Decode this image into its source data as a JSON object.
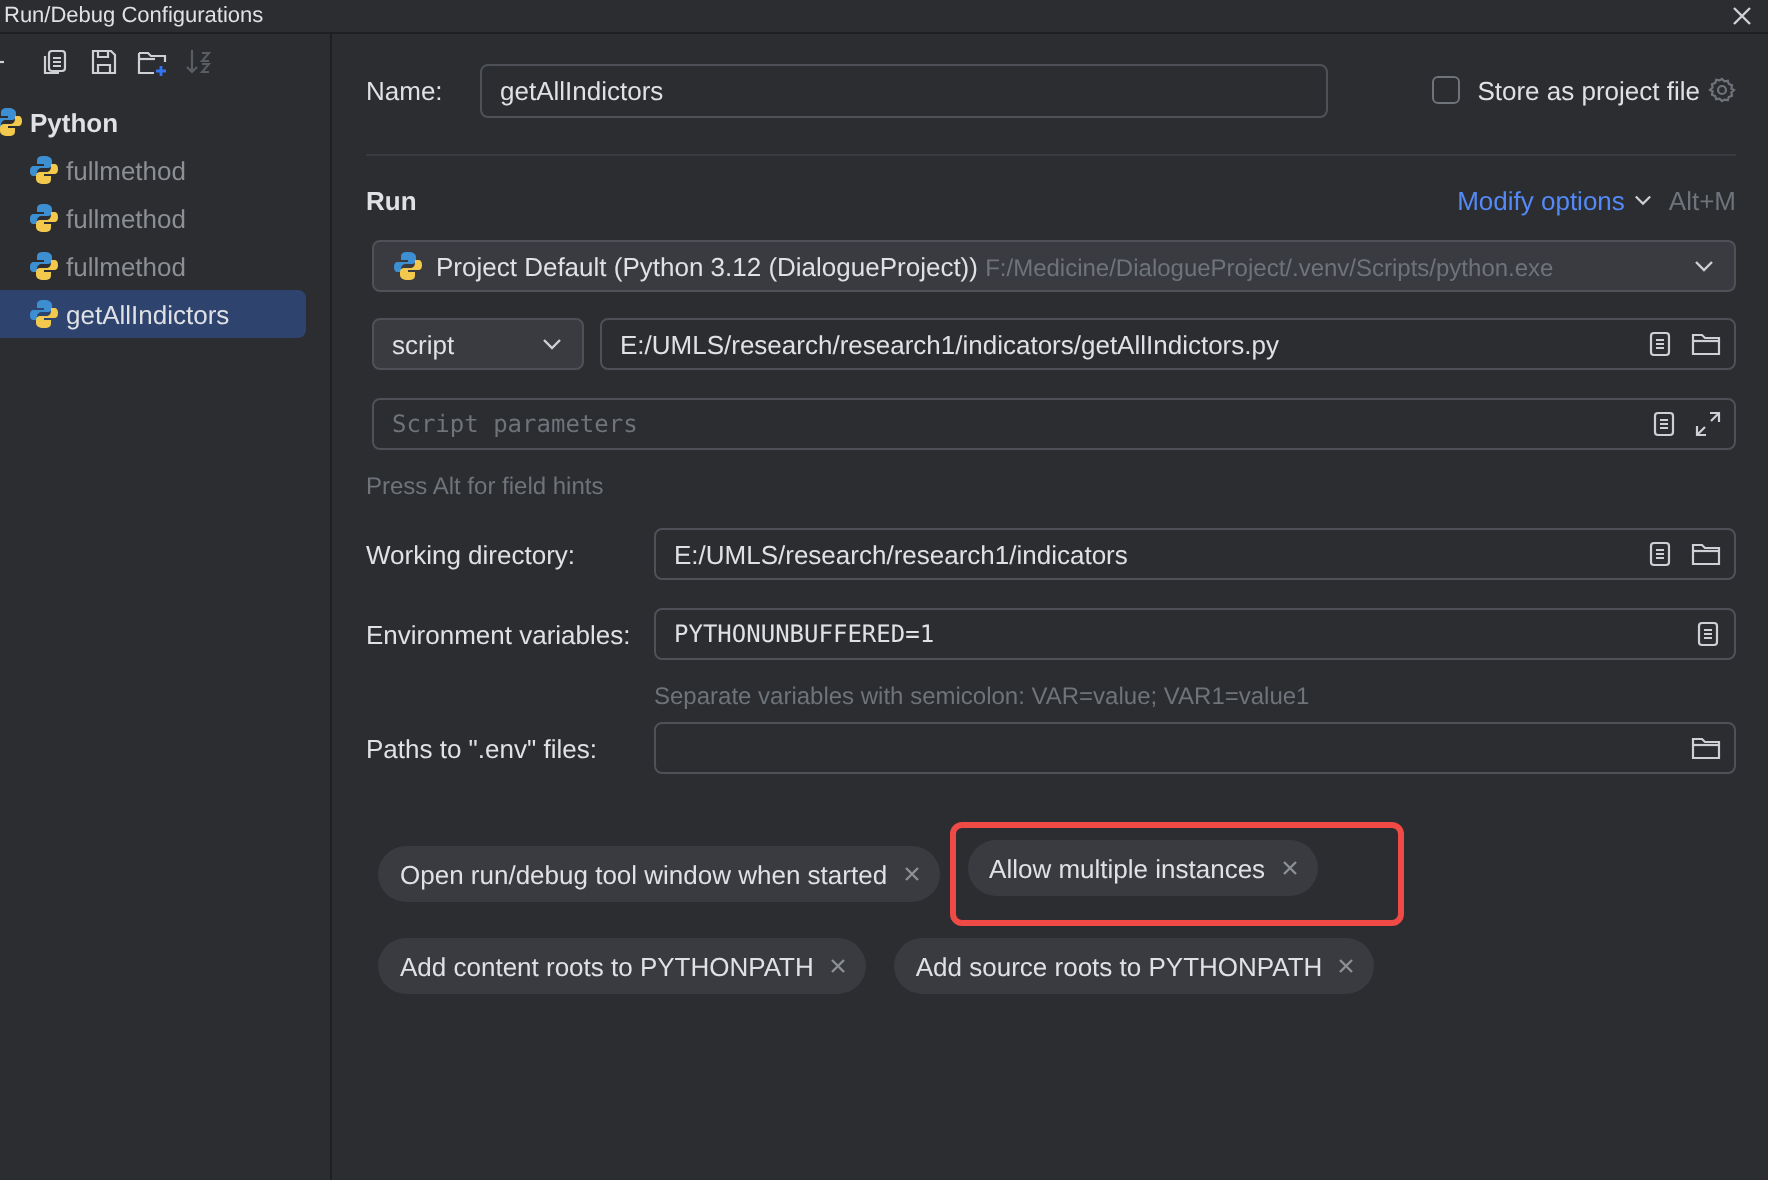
{
  "window": {
    "title": "Run/Debug Configurations"
  },
  "toolbar": [
    {
      "kind": "remove",
      "disabled": false
    },
    {
      "kind": "copy",
      "disabled": false
    },
    {
      "kind": "save",
      "disabled": false
    },
    {
      "kind": "new-folder",
      "disabled": false
    },
    {
      "kind": "sort",
      "disabled": true
    }
  ],
  "tree": [
    {
      "label": "Python",
      "selected": false,
      "temporary": false,
      "children": [
        {
          "label": "fullmethod",
          "selected": false,
          "temporary": true
        },
        {
          "label": "fullmethod",
          "selected": false,
          "temporary": true
        },
        {
          "label": "fullmethod",
          "selected": false,
          "temporary": true
        },
        {
          "label": "getAllIndictors",
          "selected": true,
          "temporary": false
        }
      ]
    }
  ],
  "name": {
    "label": "Name:",
    "value": "getAllIndictors"
  },
  "store": {
    "label": "Store as project file",
    "checked": false
  },
  "section": {
    "title": "Run",
    "link": "Modify options",
    "shortcut": "Alt+M"
  },
  "interpreter": {
    "name": "Project Default (Python 3.12 (DialogueProject))",
    "path": "F:/Medicine/DialogueProject/.venv/Scripts/python.exe"
  },
  "target": {
    "type": "script",
    "value": "E:/UMLS/research/research1/indicators/getAllIndictors.py"
  },
  "parameters": {
    "placeholder": "Script parameters"
  },
  "hint": "Press Alt for field hints",
  "fields": [
    {
      "label": "Working directory:",
      "value": "E:/UMLS/research/research1/indicators",
      "mono": false,
      "list_button": true,
      "folder_button": true
    },
    {
      "label": "Environment variables:",
      "value": "PYTHONUNBUFFERED=1",
      "mono": true,
      "list_button": true,
      "folder_button": false,
      "note": "Separate variables with semicolon: VAR=value; VAR1=value1"
    },
    {
      "label": "Paths to \".env\" files:",
      "list_button": false,
      "folder_button": true
    }
  ],
  "chip_rows": [
    [
      {
        "label": "Open run/debug tool window when started",
        "highlighted": false
      },
      {
        "label": "Allow multiple instances",
        "highlighted": true
      }
    ],
    [
      {
        "label": "Add content roots to PYTHONPATH",
        "highlighted": false
      },
      {
        "label": "Add source roots to PYTHONPATH",
        "highlighted": false
      }
    ]
  ]
}
